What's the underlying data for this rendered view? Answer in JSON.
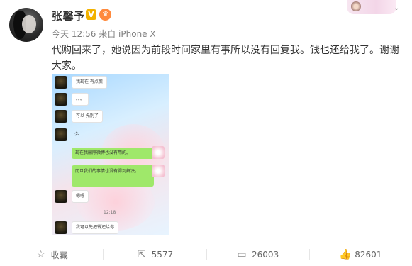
{
  "post": {
    "username": "张馨予",
    "vip_badge": "V",
    "crown_badge": "♛",
    "timestamp": "今天 12:56",
    "source": "来自 iPhone X",
    "text": "代购回来了，她说因为前段时间家里有事所以没有回复我。钱也还给我了。谢谢大家。"
  },
  "chat_image": {
    "messages": [
      {
        "side": "left",
        "text": "我现在 有点慌"
      },
      {
        "side": "left",
        "text": "。。。"
      },
      {
        "side": "left",
        "text": "可以 先别了"
      },
      {
        "side": "left",
        "text": "么"
      },
      {
        "side": "right",
        "text": "现在我删除微博也没有用的。"
      },
      {
        "side": "right",
        "text": "而且我们的事情也没有得到解决。"
      },
      {
        "side": "left",
        "text": "嗯嗯"
      },
      {
        "side": "left",
        "text": "我可以先把钱还给你"
      }
    ],
    "time_label": "12:18"
  },
  "actions": {
    "favorite": {
      "label": "收藏",
      "icon": "star-icon"
    },
    "forward": {
      "label": "5577",
      "icon": "share-icon"
    },
    "comment": {
      "label": "26003",
      "icon": "comment-icon"
    },
    "like": {
      "label": "82601",
      "icon": "thumbs-up-icon"
    }
  },
  "colors": {
    "badge_gold": "#f2b200",
    "wechat_green": "#9fe86a",
    "meta_gray": "#808080"
  }
}
